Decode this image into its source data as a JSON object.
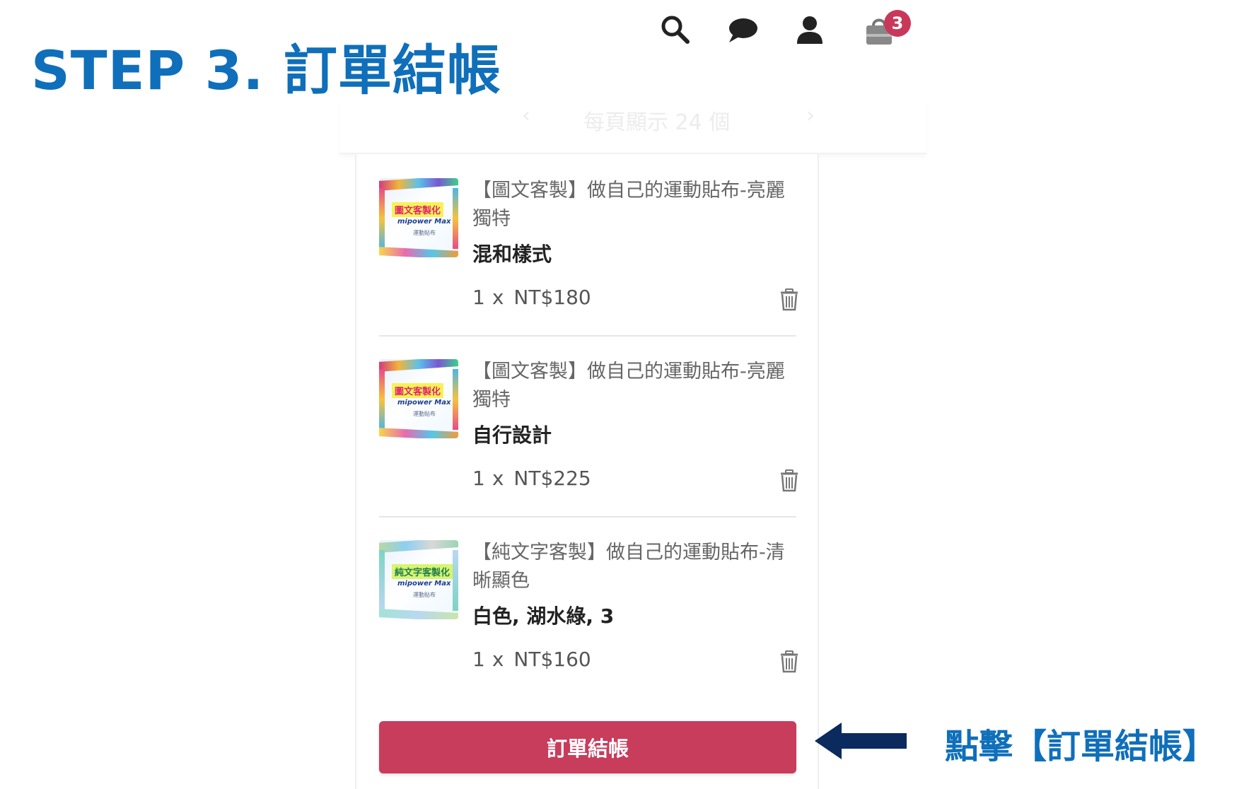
{
  "title": "STEP 3. 訂單結帳",
  "header": {
    "icons": [
      "search-icon",
      "chat-icon",
      "user-icon",
      "shopping-bag-icon"
    ],
    "cart_count": "3"
  },
  "background_hint": {
    "text": "每頁顯示 24 個"
  },
  "cart": {
    "items": [
      {
        "name": "【圖文客製】做自己的運動貼布-亮麗獨特",
        "variant": "混和樣式",
        "qty": "1",
        "x": "x",
        "price": "NT$180",
        "thumb": {
          "badge": "圖文客製化",
          "brand": "mipower Max",
          "sub": "運動貼布"
        }
      },
      {
        "name": "【圖文客製】做自己的運動貼布-亮麗獨特",
        "variant": "自行設計",
        "qty": "1",
        "x": "x",
        "price": "NT$225",
        "thumb": {
          "badge": "圖文客製化",
          "brand": "mipower Max",
          "sub": "運動貼布"
        }
      },
      {
        "name": "【純文字客製】做自己的運動貼布-清晰顯色",
        "variant": "白色, 湖水綠, 3",
        "qty": "1",
        "x": "x",
        "price": "NT$160",
        "thumb": {
          "badge": "純文字客製化",
          "brand": "mipower Max",
          "sub": "運動貼布"
        }
      }
    ],
    "checkout_label": "訂單結帳"
  },
  "annotation": {
    "text": "點擊【訂單結帳】"
  },
  "colors": {
    "title": "#0f6fba",
    "checkout_button": "#c83c5c",
    "badge": "#c8385a",
    "arrow": "#0b2a5e",
    "icon": "#222222"
  }
}
